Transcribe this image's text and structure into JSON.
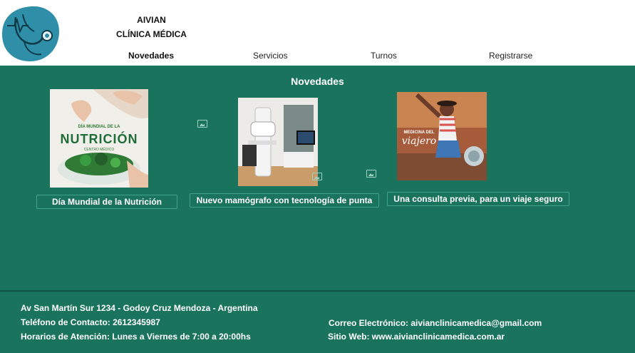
{
  "brand": {
    "line1": "AIVIAN",
    "line2": "CLÍNICA MÉDICA",
    "logo_icon": "stethoscope-heartbeat-icon"
  },
  "nav": [
    {
      "label": "Novedades",
      "active": true
    },
    {
      "label": "Servicios",
      "active": false
    },
    {
      "label": "Turnos",
      "active": false
    },
    {
      "label": "Registrarse",
      "active": false
    }
  ],
  "main": {
    "title": "Novedades",
    "cards": [
      {
        "caption": "Día Mundial de la Nutrición",
        "image_text": {
          "subtitle": "DÍA MUNDIAL DE LA",
          "title": "NUTRICIÓN",
          "brand": "CENTRO MÉDICO"
        }
      },
      {
        "caption": "Nuevo mamógrafo con tecnología de punta"
      },
      {
        "caption": "Una  consulta previa, para un viaje seguro",
        "image_text": {
          "line1": "MEDICINA DEL",
          "line2": "viajero"
        }
      }
    ]
  },
  "footer": {
    "address": "Av  San Martín Sur 1234 - Godoy Cruz  Mendoza - Argentina",
    "phone": "Teléfono de Contacto: 2612345987",
    "hours": "Horarios de Atención:  Lunes a Viernes de 7:00 a 20:00hs",
    "email": "Correo Electrónico: aivianclinicamedica@gmail.com",
    "website": "Sitio Web: www.aivianclinicamedica.com.ar"
  },
  "colors": {
    "primary_green": "#1a735d",
    "logo_teal": "#2f8fa8"
  }
}
